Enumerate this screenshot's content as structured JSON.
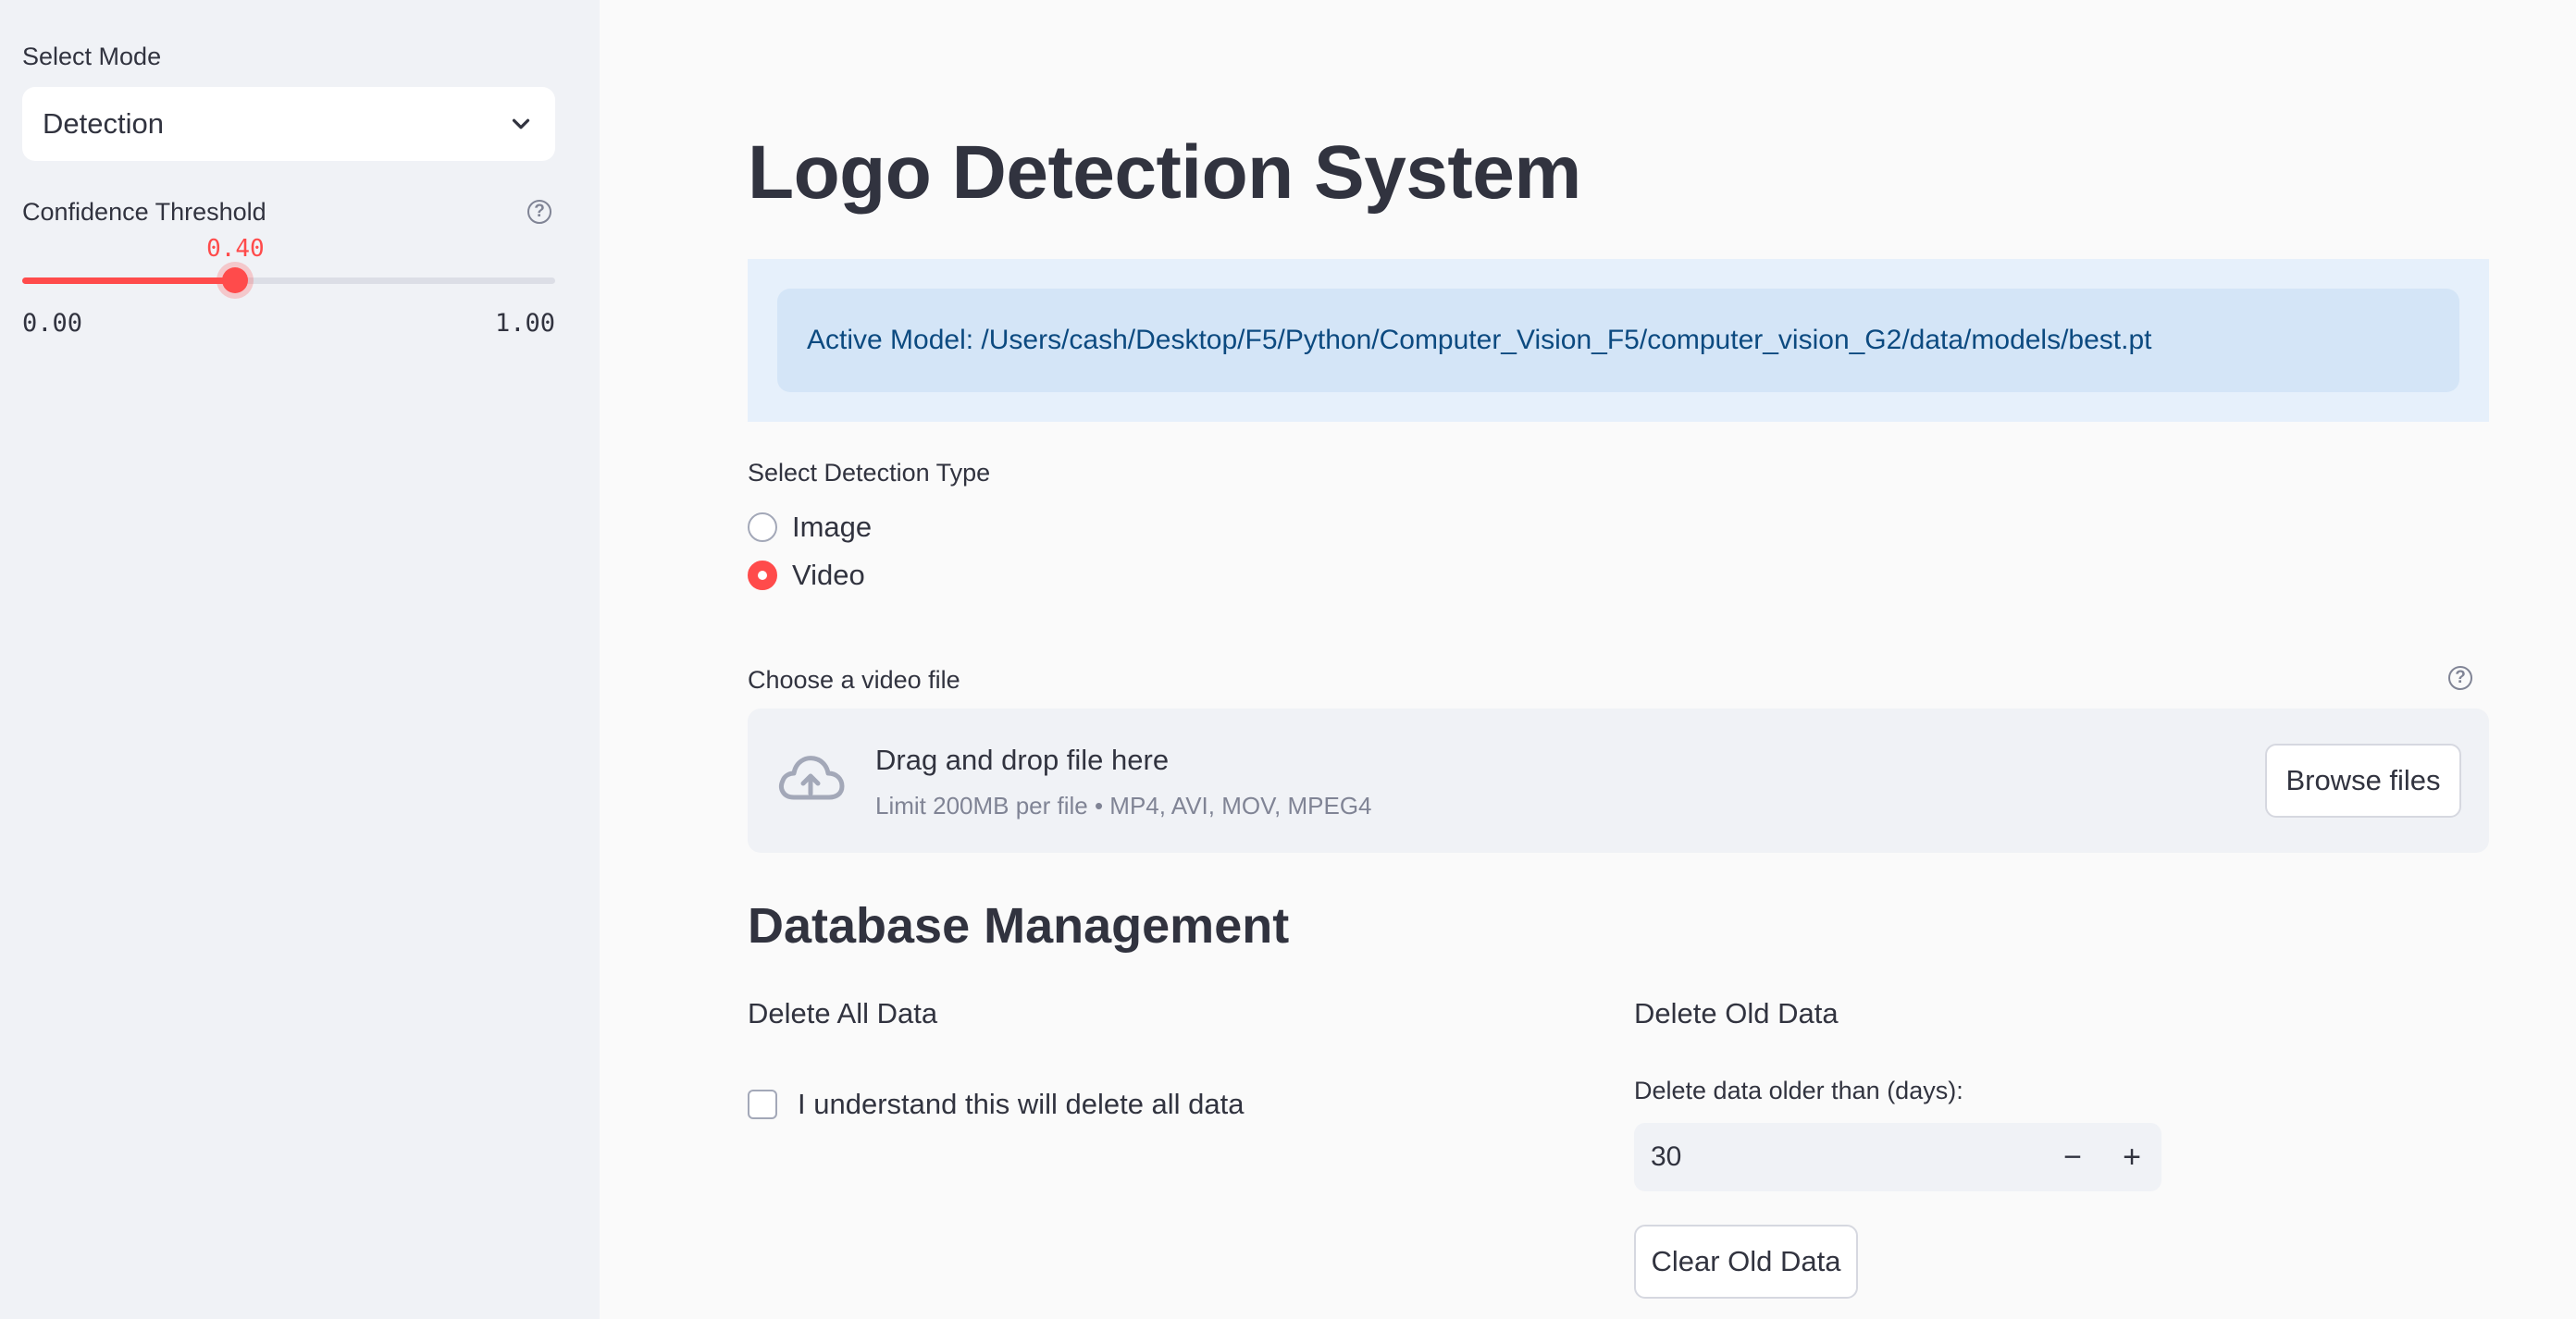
{
  "sidebar": {
    "mode_label": "Select Mode",
    "mode_value": "Detection",
    "threshold_label": "Confidence Threshold",
    "threshold_value": "0.40",
    "threshold_fraction": 0.4,
    "threshold_min": "0.00",
    "threshold_max": "1.00"
  },
  "main": {
    "title": "Logo Detection System",
    "active_model": "Active Model: /Users/cash/Desktop/F5/Python/Computer_Vision_F5/computer_vision_G2/data/models/best.pt",
    "detection_type_label": "Select Detection Type",
    "detection_options": [
      {
        "label": "Image",
        "selected": false
      },
      {
        "label": "Video",
        "selected": true
      }
    ],
    "uploader": {
      "label": "Choose a video file",
      "drop_text": "Drag and drop file here",
      "limit_text": "Limit 200MB per file • MP4, AVI, MOV, MPEG4",
      "browse_label": "Browse files"
    },
    "db": {
      "heading": "Database Management",
      "delete_all_heading": "Delete All Data",
      "confirm_label": "I understand this will delete all data",
      "delete_old_heading": "Delete Old Data",
      "days_label": "Delete data older than (days):",
      "days_value": "30",
      "minus": "−",
      "plus": "+",
      "clear_label": "Clear Old Data"
    }
  },
  "colors": {
    "accent": "#ff4b4b",
    "sidebar_bg": "#f0f2f6",
    "info_bg": "#d4e5f7",
    "info_text": "#0c4a80"
  }
}
